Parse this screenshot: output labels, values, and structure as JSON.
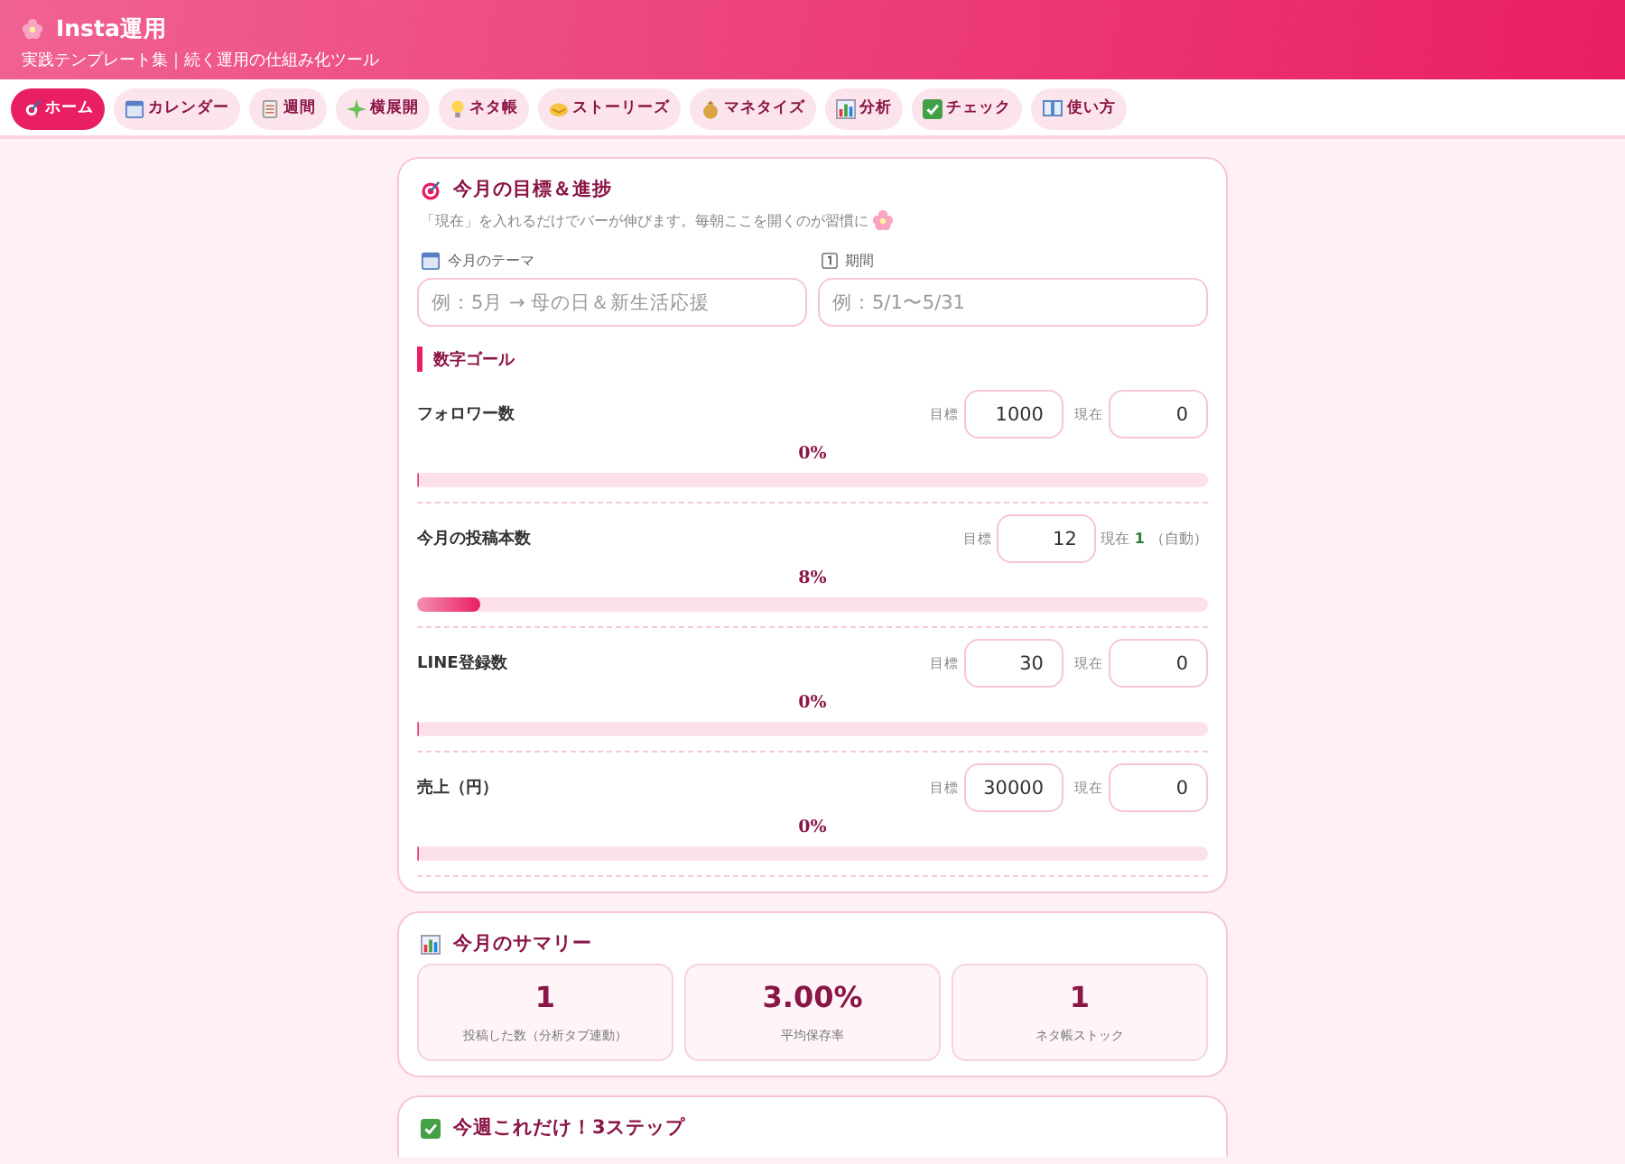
{
  "header": {
    "title": "Insta運用",
    "subtitle": "実践テンプレート集｜続く運用の仕組み化ツール"
  },
  "tabs": [
    {
      "label": "ホーム",
      "selected": true
    },
    {
      "label": "カレンダー",
      "selected": false
    },
    {
      "label": "週間",
      "selected": false
    },
    {
      "label": "横展開",
      "selected": false
    },
    {
      "label": "ネタ帳",
      "selected": false
    },
    {
      "label": "ストーリーズ",
      "selected": false
    },
    {
      "label": "マネタイズ",
      "selected": false
    },
    {
      "label": "分析",
      "selected": false
    },
    {
      "label": "チェック",
      "selected": false
    },
    {
      "label": "使い方",
      "selected": false
    }
  ],
  "goals_card": {
    "title": "今月の目標＆進捗",
    "hint": "「現在」を入れるだけでバーが伸びます。毎朝ここを開くのが習慣に",
    "theme_field": {
      "label": "今月のテーマ",
      "placeholder": "例：5月 → 母の日＆新生活応援"
    },
    "period_field": {
      "label": "期間",
      "placeholder": "例：5/1〜5/31"
    },
    "section_title": "数字ゴール",
    "goals": [
      {
        "kind": "manual",
        "name": "フォロワー数",
        "target_label": "目標",
        "target": "1000",
        "current_label": "現在",
        "current": "0",
        "percent": "0%",
        "level": 0
      },
      {
        "kind": "auto",
        "name": "今月の投稿本数",
        "target_label": "目標",
        "target": "12",
        "current_label": "現在",
        "current": "1",
        "auto_note": "（自動）",
        "percent": "8%",
        "level": 0.08
      },
      {
        "kind": "manual",
        "name": "LINE登録数",
        "target_label": "目標",
        "target": "30",
        "current_label": "現在",
        "current": "0",
        "percent": "0%",
        "level": 0
      },
      {
        "kind": "manual",
        "name": "売上（円）",
        "target_label": "目標",
        "target": "30000",
        "current_label": "現在",
        "current": "0",
        "percent": "0%",
        "level": 0
      }
    ]
  },
  "summary_card": {
    "title": "今月のサマリー",
    "stats": [
      {
        "value": "1",
        "label": "投稿した数（分析タブ連動）"
      },
      {
        "value": "3.00%",
        "label": "平均保存率"
      },
      {
        "value": "1",
        "label": "ネタ帳ストック"
      }
    ]
  },
  "steps_card": {
    "title": "今週これだけ！3ステップ"
  }
}
